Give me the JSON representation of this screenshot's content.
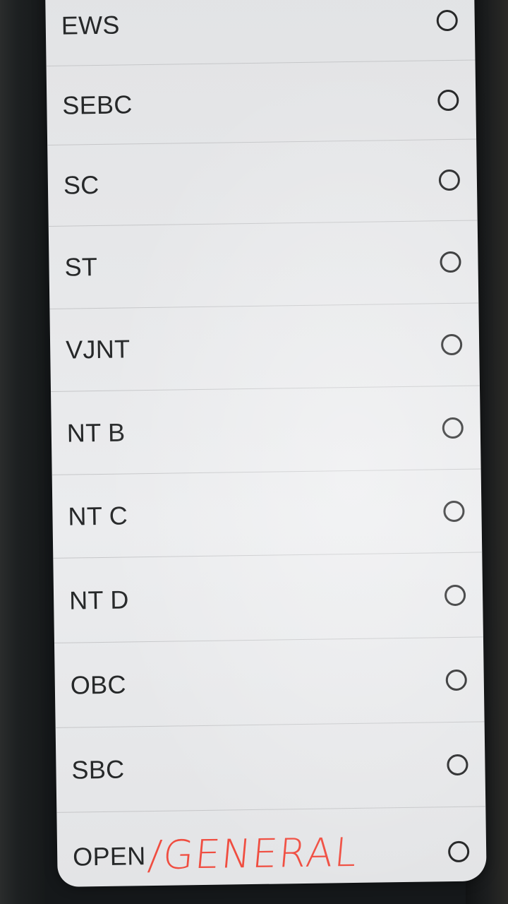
{
  "options": [
    {
      "label": "EWS",
      "selected": false
    },
    {
      "label": "SEBC",
      "selected": false
    },
    {
      "label": "SC",
      "selected": false
    },
    {
      "label": "ST",
      "selected": false
    },
    {
      "label": "VJNT",
      "selected": false
    },
    {
      "label": "NT B",
      "selected": false
    },
    {
      "label": "NT C",
      "selected": false
    },
    {
      "label": "NT D",
      "selected": false
    },
    {
      "label": "OBC",
      "selected": false
    },
    {
      "label": "SBC",
      "selected": false
    },
    {
      "label": "OPEN",
      "selected": false
    }
  ],
  "annotation": {
    "text": "/GENERAL",
    "color": "#f04d40"
  },
  "colors": {
    "sheet": "#e7e8ea",
    "text": "#262829",
    "divider": "#c6c7c9"
  },
  "icons": {
    "row_control": "radio-button-unchecked-icon"
  }
}
